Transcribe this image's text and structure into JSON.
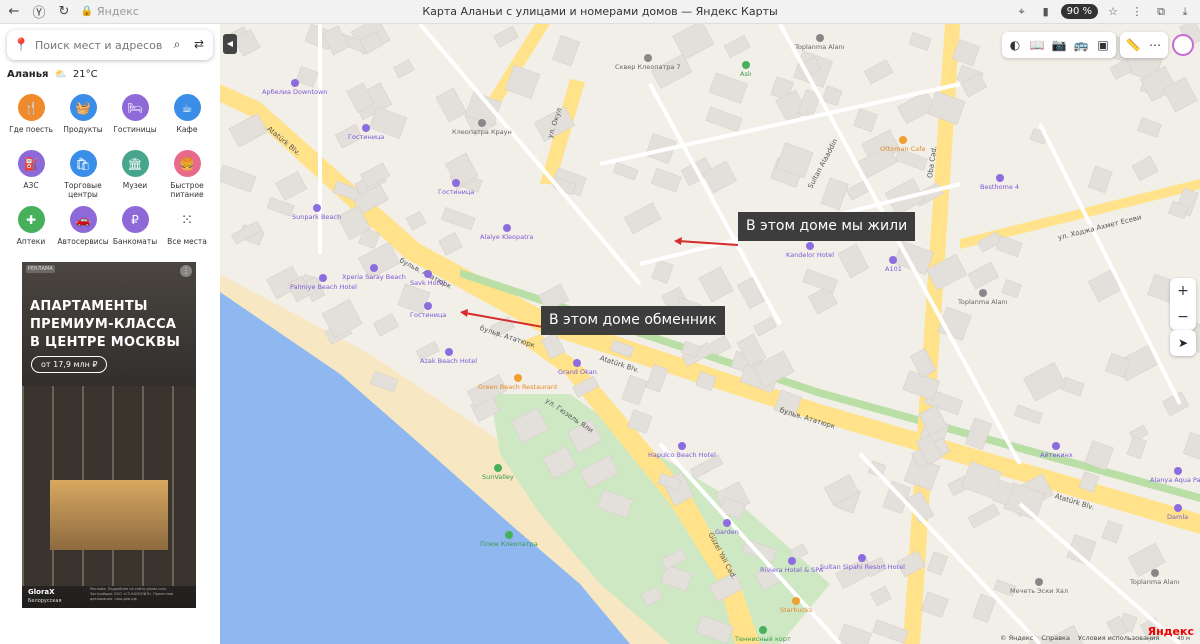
{
  "browser": {
    "tab_title": "Карта Аланьи с улицами и номерами домов — Яндекс Карты",
    "url_text": "Яндекс",
    "zoom": "90 %"
  },
  "search": {
    "placeholder": "Поиск мест и адресов"
  },
  "city": {
    "name": "Аланья",
    "temperature": "21°C"
  },
  "categories": [
    {
      "label": "Где поесть",
      "color": "#f08a2a"
    },
    {
      "label": "Продукты",
      "color": "#3a8ee8"
    },
    {
      "label": "Гостиницы",
      "color": "#8e6ad8"
    },
    {
      "label": "Кафе",
      "color": "#3a8ee8"
    },
    {
      "label": "АЗС",
      "color": "#8e6ad8"
    },
    {
      "label": "Торговые центры",
      "color": "#3a8ee8"
    },
    {
      "label": "Музеи",
      "color": "#46a58c"
    },
    {
      "label": "Быстрое питание",
      "color": "#e86a8a"
    },
    {
      "label": "Аптеки",
      "color": "#46b05a"
    },
    {
      "label": "Автосервисы",
      "color": "#8e6ad8"
    },
    {
      "label": "Банкоматы",
      "color": "#8e6ad8"
    },
    {
      "label": "Все места",
      "color": "#ffffff"
    }
  ],
  "ad": {
    "tag": "РЕКЛАМА",
    "headline": "АПАРТАМЕНТЫ ПРЕМИУМ-КЛАССА В ЦЕНТРЕ МОСКВЫ",
    "price": "от 17,9 млн ₽",
    "brand": "GloraX",
    "brand_sub": "Белорусская",
    "fine_print": "Реклама. Подробнее на сайте glorax.com. Застройщик ООО «СЗ КАСКОЙЛ». Проектная декларация: наш.дом.рф"
  },
  "callouts": {
    "lived": "В этом доме мы жили",
    "exchange": "В этом доме обменник"
  },
  "pois": {
    "arpelia": "Арбелиа Downtown",
    "ottoman": "Ottoman Cafe",
    "besthome": "Besthome 4",
    "toplanma_top": "Toplanma Alanı",
    "kleopatra_sq": "Сквер Клеопатра 7",
    "kleopatra_crown": "Клеопатра Краун",
    "hotel1": "Гостиница",
    "hotel2": "Гостиница",
    "hotel3": "Гостиница",
    "sunpark": "Sunpark Beach",
    "alaiye": "Alaiye Kleopatra",
    "kandelor": "Kandelor Hotel",
    "toplanma_mid": "Toplanma Alanı",
    "seaside": "Xperia Saray Beach",
    "savk": "Savk Hotel",
    "palmiye": "Palmiye Beach Hotel",
    "azak": "Azak Beach Hotel",
    "greenbeach": "Green Beach Restaurant",
    "grandokan": "Grand Okan",
    "garden": "Garden",
    "hapulco": "Hapulco Beach Hotel",
    "sunvalley": "SunValley",
    "kleopatra_beach": "Пляж Клеопатра",
    "riviera": "Riviera Hotel & SPA",
    "sultan": "Sultan Sipahi Resort Hotel",
    "starbucks": "Starbucks",
    "mechet": "Мечеть Эски Хал",
    "alanya_aqua": "Alanya Aqua Park",
    "damla": "Damla",
    "tennis": "Теннисный корт",
    "a101": "A101",
    "aitekin": "Айтекинх",
    "toplanma_right": "Toplanma Alanı",
    "asli": "Aslı"
  },
  "streets": {
    "ataturk1": "бульв. Ататюрк",
    "ataturk2": "Atatürk Blv.",
    "ataturk3": "бульв. Ататюрк",
    "ataturk4": "Atatürk Blv.",
    "ataturk5": "бульв. Ататюрк",
    "guzel": "ул. Гюзель Яли",
    "guzelyali": "Güzel Yali Cad.",
    "oba": "Oba Cad.",
    "ataturk_left": "Atatürk Blv.",
    "hoca": "ул. Ходжа Ахмет Есеви",
    "sultan_alaaddin": "Sultan Alaaddin",
    "okul": "ул. Окул"
  },
  "footer": {
    "copyright": "© Яндекс",
    "help": "Справка",
    "terms": "Условия использования",
    "brand": "Яндекс",
    "scale": "40 м"
  }
}
